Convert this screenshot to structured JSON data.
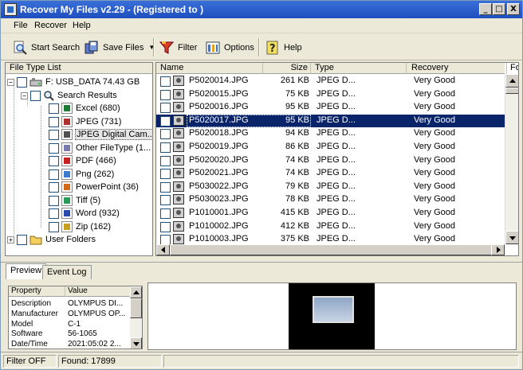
{
  "window": {
    "title": "Recover My Files v2.29  -  (Registered to )",
    "min": "_",
    "max": "□",
    "close": "X"
  },
  "menu": [
    "File",
    "Recover",
    "Help"
  ],
  "toolbar": {
    "start_search": "Start Search",
    "save_files": "Save Files",
    "filter": "Filter",
    "options": "Options",
    "help": "Help"
  },
  "tree": {
    "header": "File Type List",
    "drive": "F: USB_DATA  74.43 GB",
    "search_results": "Search Results",
    "items": [
      {
        "label": "Excel  (680)",
        "color": "#1e7b34"
      },
      {
        "label": "JPEG  (731)",
        "color": "#b03030"
      },
      {
        "label": "JPEG Digital Cam...",
        "color": "#505050"
      },
      {
        "label": "Other FileType  (1...",
        "color": "#7a7ab0"
      },
      {
        "label": "PDF  (466)",
        "color": "#c82020"
      },
      {
        "label": "Png  (262)",
        "color": "#3a7ad0"
      },
      {
        "label": "PowerPoint  (36)",
        "color": "#d06a1a"
      },
      {
        "label": "Tiff  (5)",
        "color": "#2a9a5a"
      },
      {
        "label": "Word  (932)",
        "color": "#2a4ab0"
      },
      {
        "label": "Zip  (162)",
        "color": "#c8a020"
      }
    ],
    "user_folders": "User Folders"
  },
  "columns": {
    "name": "Name",
    "size": "Size",
    "type": "Type",
    "recovery": "Recovery",
    "extra": "Fo"
  },
  "files": [
    {
      "name": "P5020014.JPG",
      "size": "261 KB",
      "type": "JPEG D...",
      "recovery": "Very Good"
    },
    {
      "name": "P5020015.JPG",
      "size": "75 KB",
      "type": "JPEG D...",
      "recovery": "Very Good"
    },
    {
      "name": "P5020016.JPG",
      "size": "95 KB",
      "type": "JPEG D...",
      "recovery": "Very Good"
    },
    {
      "name": "P5020017.JPG",
      "size": "95 KB",
      "type": "JPEG D...",
      "recovery": "Very Good"
    },
    {
      "name": "P5020018.JPG",
      "size": "94 KB",
      "type": "JPEG D...",
      "recovery": "Very Good"
    },
    {
      "name": "P5020019.JPG",
      "size": "86 KB",
      "type": "JPEG D...",
      "recovery": "Very Good"
    },
    {
      "name": "P5020020.JPG",
      "size": "74 KB",
      "type": "JPEG D...",
      "recovery": "Very Good"
    },
    {
      "name": "P5020021.JPG",
      "size": "74 KB",
      "type": "JPEG D...",
      "recovery": "Very Good"
    },
    {
      "name": "P5030022.JPG",
      "size": "79 KB",
      "type": "JPEG D...",
      "recovery": "Very Good"
    },
    {
      "name": "P5030023.JPG",
      "size": "78 KB",
      "type": "JPEG D...",
      "recovery": "Very Good"
    },
    {
      "name": "P1010001.JPG",
      "size": "415 KB",
      "type": "JPEG D...",
      "recovery": "Very Good"
    },
    {
      "name": "P1010002.JPG",
      "size": "412 KB",
      "type": "JPEG D...",
      "recovery": "Very Good"
    },
    {
      "name": "P1010003.JPG",
      "size": "375 KB",
      "type": "JPEG D...",
      "recovery": "Very Good"
    }
  ],
  "tabs": {
    "preview": "Preview",
    "event_log": "Event Log"
  },
  "properties": {
    "header_key": "Property",
    "header_value": "Value",
    "rows": [
      {
        "k": "Description",
        "v": "OLYMPUS DI..."
      },
      {
        "k": "Manufacturer",
        "v": "OLYMPUS OP..."
      },
      {
        "k": "Model",
        "v": "C-1"
      },
      {
        "k": "Software",
        "v": "56-1065"
      },
      {
        "k": "Date/Time",
        "v": "2021:05:02 2..."
      }
    ]
  },
  "status": {
    "filter": "Filter OFF",
    "found": "Found: 17899"
  }
}
